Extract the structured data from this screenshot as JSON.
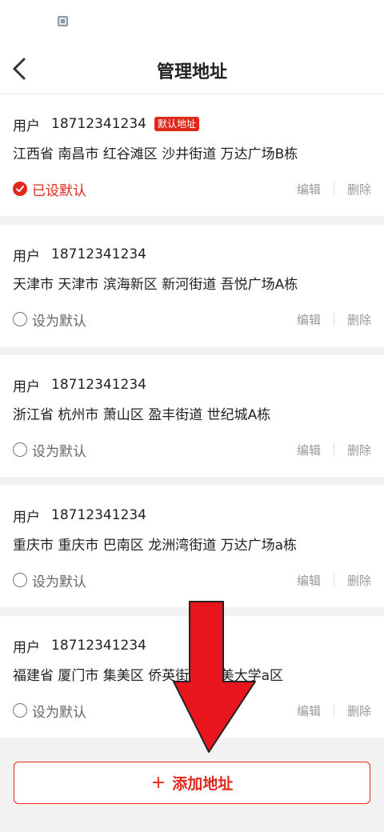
{
  "nav": {
    "title": "管理地址"
  },
  "addresses": [
    {
      "name": "用户",
      "phone": "18712341234",
      "badge": "默认地址",
      "address": "江西省 南昌市 红谷滩区 沙井街道 万达广场B栋",
      "default_label": "已设默认",
      "is_default": true,
      "edit": "编辑",
      "delete": "删除"
    },
    {
      "name": "用户",
      "phone": "18712341234",
      "badge": "",
      "address": "天津市 天津市 滨海新区 新河街道 吾悦广场A栋",
      "default_label": "设为默认",
      "is_default": false,
      "edit": "编辑",
      "delete": "删除"
    },
    {
      "name": "用户",
      "phone": "18712341234",
      "badge": "",
      "address": "浙江省 杭州市 萧山区 盈丰街道 世纪城A栋",
      "default_label": "设为默认",
      "is_default": false,
      "edit": "编辑",
      "delete": "删除"
    },
    {
      "name": "用户",
      "phone": "18712341234",
      "badge": "",
      "address": "重庆市 重庆市 巴南区 龙洲湾街道 万达广场a栋",
      "default_label": "设为默认",
      "is_default": false,
      "edit": "编辑",
      "delete": "删除"
    },
    {
      "name": "用户",
      "phone": "18712341234",
      "badge": "",
      "address": "福建省 厦门市 集美区 侨英街道 集美大学a区",
      "default_label": "设为默认",
      "is_default": false,
      "edit": "编辑",
      "delete": "删除"
    }
  ],
  "add_button": {
    "plus": "+",
    "label": "添加地址"
  },
  "colors": {
    "accent": "#e0291a",
    "arrow": "#e8161c"
  },
  "icons": {
    "back": "chevron-left-icon",
    "check": "check-icon",
    "arrow": "down-arrow-annotation-icon"
  }
}
